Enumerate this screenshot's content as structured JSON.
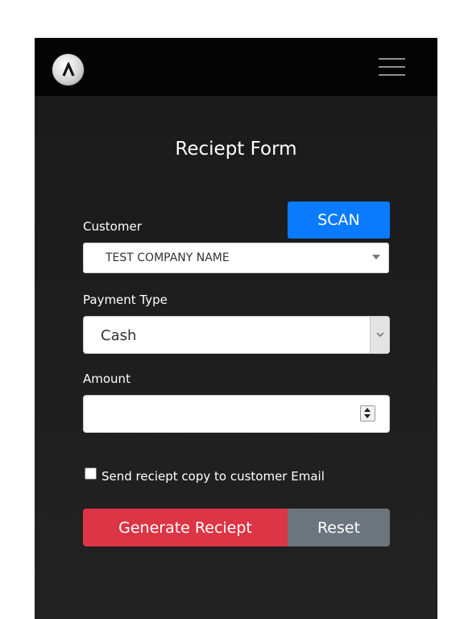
{
  "header": {
    "logo_icon": "logo-lambda-icon",
    "menu_icon": "hamburger-menu-icon"
  },
  "form": {
    "title": "Reciept Form",
    "customer_label": "Customer",
    "scan_label": "SCAN",
    "customer_value": "TEST COMPANY NAME",
    "payment_type_label": "Payment Type",
    "payment_type_value": "Cash",
    "amount_label": "Amount",
    "amount_value": "",
    "send_copy_label": "Send reciept copy to customer Email",
    "send_copy_checked": false,
    "generate_label": "Generate Reciept",
    "reset_label": "Reset"
  },
  "colors": {
    "scan_button": "#0a7bff",
    "generate_button": "#dc3545",
    "reset_button": "#6c757d",
    "background": "#1e1e1e"
  }
}
